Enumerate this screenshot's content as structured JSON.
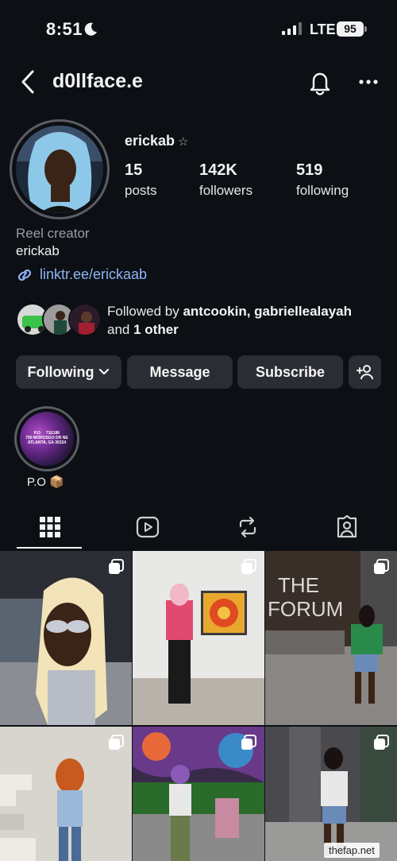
{
  "status_bar": {
    "time": "8:51",
    "network": "LTE",
    "battery": "95"
  },
  "header": {
    "title": "d0llface.e",
    "back_icon": "chevron-left-icon",
    "bell_icon": "bell-icon",
    "more_icon": "ellipsis-icon"
  },
  "profile": {
    "username": "erickab",
    "star": "☆",
    "stats": [
      {
        "value": "15",
        "label": "posts"
      },
      {
        "value": "142K",
        "label": "followers"
      },
      {
        "value": "519",
        "label": "following"
      }
    ],
    "category": "Reel creator",
    "bio_name": "erickab",
    "link": "linktr.ee/erickaab"
  },
  "followed_by": {
    "prefix": "Followed by ",
    "names": "antcookin, gabriellealayah",
    "joiner": "and ",
    "others": "1 other"
  },
  "buttons": {
    "following": "Following",
    "message": "Message",
    "subscribe": "Subscribe",
    "add_user_icon": "add-person-icon"
  },
  "highlight": {
    "label": "P.O 📦",
    "image_text": "P.O     71E186\n750 MOROSGO DR NE\nATLANTA, GA 30324"
  },
  "tabs": [
    {
      "name": "grid",
      "icon": "grid-icon",
      "active": true
    },
    {
      "name": "reels",
      "icon": "play-icon",
      "active": false
    },
    {
      "name": "reposts",
      "icon": "repost-icon",
      "active": false
    },
    {
      "name": "tagged",
      "icon": "tagged-person-icon",
      "active": false
    }
  ],
  "grid_posts": [
    {
      "sign_text": ""
    },
    {
      "sign_text": ""
    },
    {
      "sign_text": "THE\nFORUM"
    },
    {
      "sign_text": ""
    },
    {
      "sign_text": ""
    },
    {
      "sign_text": ""
    }
  ],
  "watermark": "thefap.net"
}
